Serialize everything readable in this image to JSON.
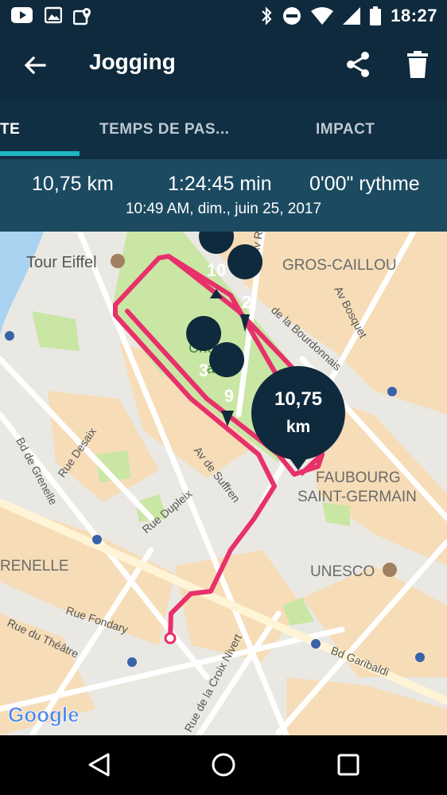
{
  "status_bar": {
    "time": "18:27",
    "icons_left": [
      "youtube-icon",
      "image-icon",
      "maps-icon"
    ],
    "icons_right": [
      "bluetooth-icon",
      "do-not-disturb-icon",
      "wifi-icon",
      "signal-icon",
      "battery-icon"
    ]
  },
  "app_bar": {
    "title": "Jogging",
    "back_icon": "arrow-back-icon",
    "share_icon": "share-icon",
    "delete_icon": "trash-icon"
  },
  "tabs": [
    {
      "label": "TE",
      "active": true
    },
    {
      "label": "TEMPS DE PAS...",
      "active": false
    },
    {
      "label": "IMPACT",
      "active": false
    }
  ],
  "stats": {
    "distance": "10,75 km",
    "duration": "1:24:45 min",
    "pace": "0'00\" rythme",
    "datetime": "10:49 AM, dim., juin 25, 2017"
  },
  "map": {
    "labels": {
      "tour_eiffel": "Tour Eiffel",
      "gros_caillou": "GROS-CAILLOU",
      "champ": "Champ",
      "mars": "ars",
      "faubourg1": "FAUBOURG",
      "faubourg2": "SAINT-GERMAIN",
      "unesco": "UNESCO",
      "grenelle": "RENELLE",
      "bd_grenelle": "Bd de Grenelle",
      "rue_desaix": "Rue Desaix",
      "av_suffren": "Av de Suffren",
      "rue_dupleix": "Rue Dupleix",
      "av_bosquet": "Av Bosquet",
      "bourdonnais": "de la Bourdonnais",
      "rue_fondary": "Rue Fondary",
      "rue_theatre": "Rue du Théâtre",
      "croix_nivert": "Rue de la Croix Nivert",
      "bd_garibaldi": "Bd Garibaldi",
      "av_r": "Av R",
      "google": "Google"
    },
    "km_markers": [
      {
        "label": "10"
      },
      {
        "label": "2"
      },
      {
        "label": "3"
      },
      {
        "label": "9"
      }
    ],
    "distance_badge": {
      "value": "10,75",
      "unit": "km"
    },
    "colors": {
      "route": "#e8306a",
      "marker": "#0f2a3c",
      "park": "#c9e6a5",
      "water": "#a9d3f0",
      "block": "#f6ddb8"
    }
  },
  "nav_bar": {
    "back": "nav-back-icon",
    "home": "nav-home-icon",
    "recents": "nav-recents-icon"
  }
}
